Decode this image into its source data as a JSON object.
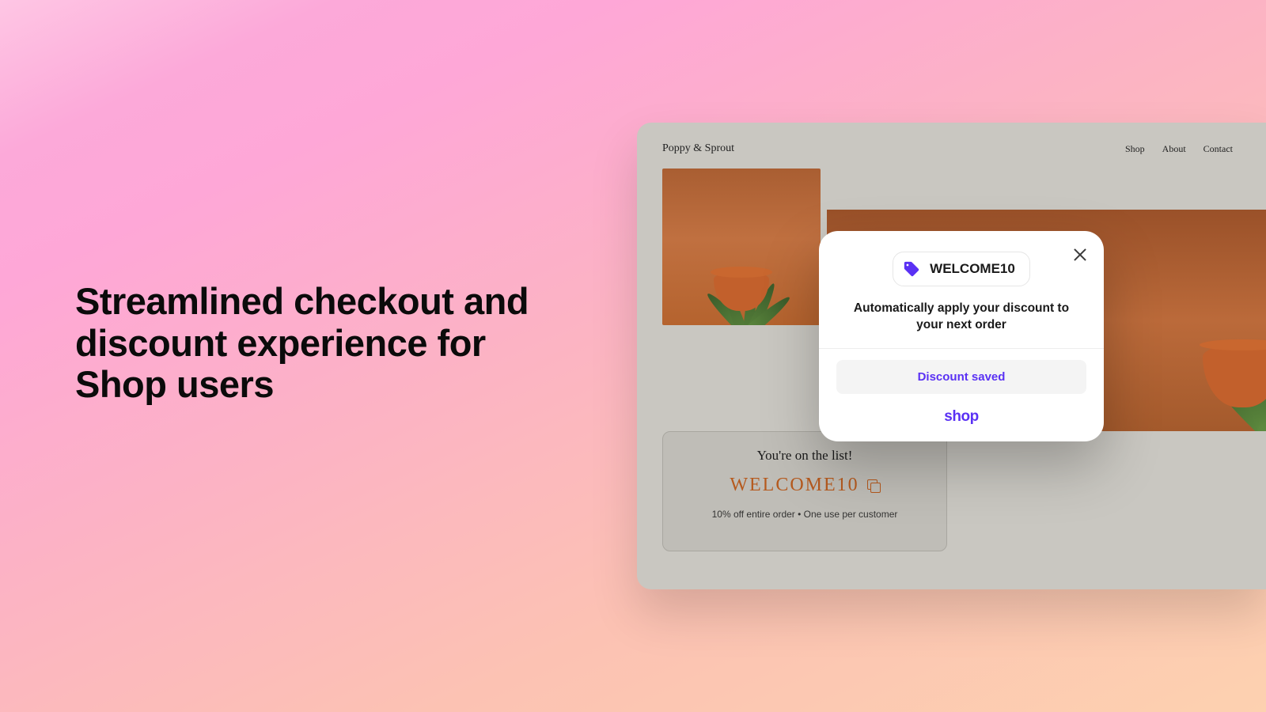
{
  "headline": "Streamlined checkout and discount experience for Shop users",
  "storefront": {
    "brand": "Poppy & Sprout",
    "nav": [
      "Shop",
      "About",
      "Contact"
    ],
    "subscribe": {
      "title": "You're on the list!",
      "code": "WELCOME10",
      "desc": "10% off entire order • One use per customer"
    }
  },
  "popup": {
    "code": "WELCOME10",
    "body": "Automatically apply your discount to your next order",
    "saved_label": "Discount saved",
    "logo": "shop"
  },
  "colors": {
    "accent_purple": "#5a31f4",
    "brand_orange": "#b65a1e"
  }
}
